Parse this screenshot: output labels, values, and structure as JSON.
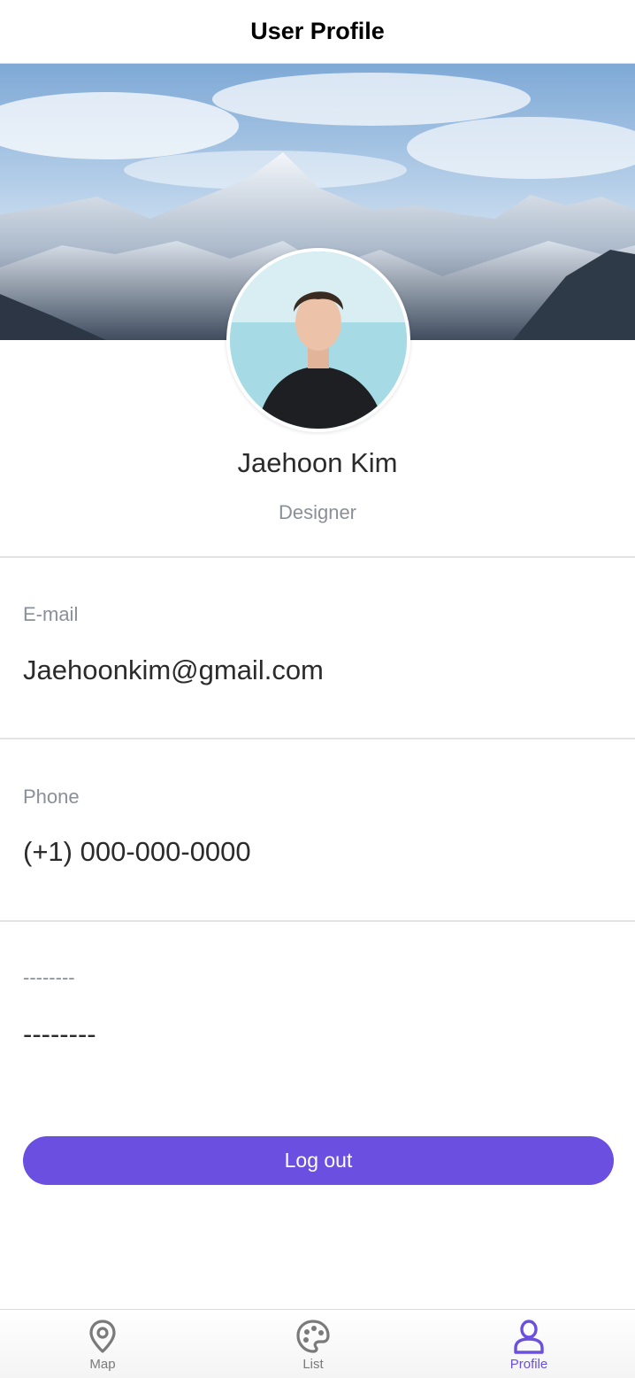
{
  "header": {
    "title": "User Profile"
  },
  "profile": {
    "name": "Jaehoon Kim",
    "role": "Designer"
  },
  "fields": [
    {
      "label": "E-mail",
      "value": "Jaehoonkim@gmail.com"
    },
    {
      "label": "Phone",
      "value": "(+1) 000-000-0000"
    },
    {
      "label": "--------",
      "value": "--------"
    }
  ],
  "actions": {
    "logout_label": "Log out"
  },
  "tabbar": {
    "items": [
      {
        "label": "Map",
        "icon": "map-pin-icon"
      },
      {
        "label": "List",
        "icon": "palette-icon"
      },
      {
        "label": "Profile",
        "icon": "person-icon",
        "active": true
      }
    ]
  },
  "colors": {
    "accent": "#6a4fe0",
    "muted_text": "#8a8f98",
    "body_text": "#2b2b2b"
  }
}
